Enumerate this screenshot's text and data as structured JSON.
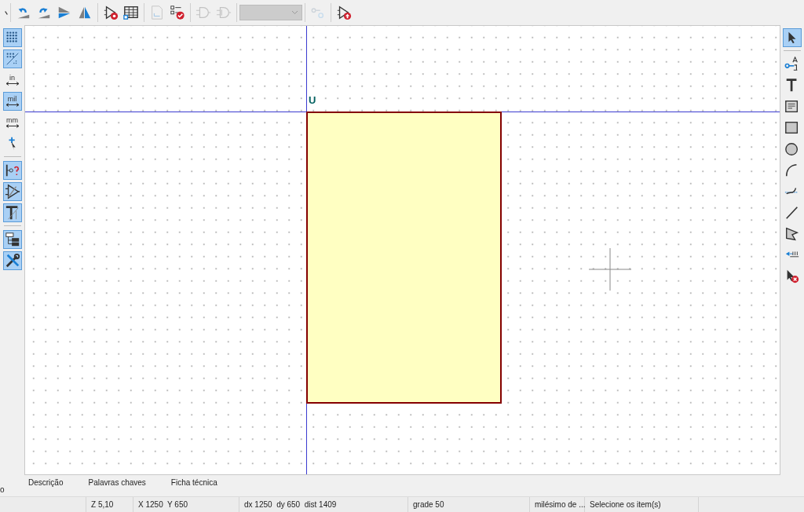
{
  "top_toolbar": {
    "items": [
      {
        "kind": "cut",
        "disabled": false
      },
      {
        "kind": "sep"
      },
      {
        "kind": "undo",
        "disabled": false
      },
      {
        "kind": "redo",
        "disabled": false
      },
      {
        "kind": "mirrorh",
        "disabled": false
      },
      {
        "kind": "mirrorv",
        "disabled": false
      },
      {
        "kind": "sep"
      },
      {
        "kind": "symbolgear",
        "disabled": false
      },
      {
        "kind": "table",
        "disabled": false
      },
      {
        "kind": "sep"
      },
      {
        "kind": "document",
        "disabled": true
      },
      {
        "kind": "checklist",
        "disabled": false
      },
      {
        "kind": "sep"
      },
      {
        "kind": "gate",
        "disabled": true
      },
      {
        "kind": "gatealt",
        "disabled": true
      },
      {
        "kind": "sep"
      },
      {
        "kind": "dropdown",
        "disabled": true
      },
      {
        "kind": "sep"
      },
      {
        "kind": "link",
        "disabled": true
      },
      {
        "kind": "sep"
      },
      {
        "kind": "symbolupload",
        "disabled": false
      }
    ]
  },
  "left_toolbar": {
    "items": [
      {
        "kind": "grid",
        "selected": true
      },
      {
        "kind": "gridoverride",
        "selected": true
      },
      {
        "kind": "unit",
        "label": "in",
        "selected": false
      },
      {
        "kind": "unit",
        "label": "mil",
        "selected": true
      },
      {
        "kind": "unit",
        "label": "mm",
        "selected": false
      },
      {
        "kind": "cursor",
        "selected": false
      },
      {
        "kind": "sep"
      },
      {
        "kind": "pincheck",
        "selected": true
      },
      {
        "kind": "pinhidden",
        "selected": true
      },
      {
        "kind": "textfield",
        "selected": true
      },
      {
        "kind": "sep"
      },
      {
        "kind": "hierarchy",
        "selected": true
      },
      {
        "kind": "tools",
        "selected": true
      }
    ]
  },
  "right_toolbar": {
    "items": [
      {
        "kind": "select",
        "selected": true
      },
      {
        "kind": "sep"
      },
      {
        "kind": "pin",
        "selected": false
      },
      {
        "kind": "text",
        "selected": false
      },
      {
        "kind": "textbox",
        "selected": false
      },
      {
        "kind": "rect",
        "selected": false
      },
      {
        "kind": "circle",
        "selected": false
      },
      {
        "kind": "arc",
        "selected": false
      },
      {
        "kind": "bezier",
        "selected": false
      },
      {
        "kind": "line",
        "selected": false
      },
      {
        "kind": "polygon",
        "selected": false
      },
      {
        "kind": "anchor",
        "selected": false
      },
      {
        "kind": "delete",
        "selected": false
      }
    ]
  },
  "canvas": {
    "reference_label": "U"
  },
  "properties": {
    "tabs": [
      "Descrição",
      "Palavras chaves",
      "Ficha técnica"
    ],
    "fragment": "o"
  },
  "status_bar": [
    "Z 5,10",
    "X 1250  Y 650",
    "dx 1250  dy 650  dist 1409",
    "grade 50",
    "milésimo de ...",
    "Selecione os item(s)"
  ]
}
